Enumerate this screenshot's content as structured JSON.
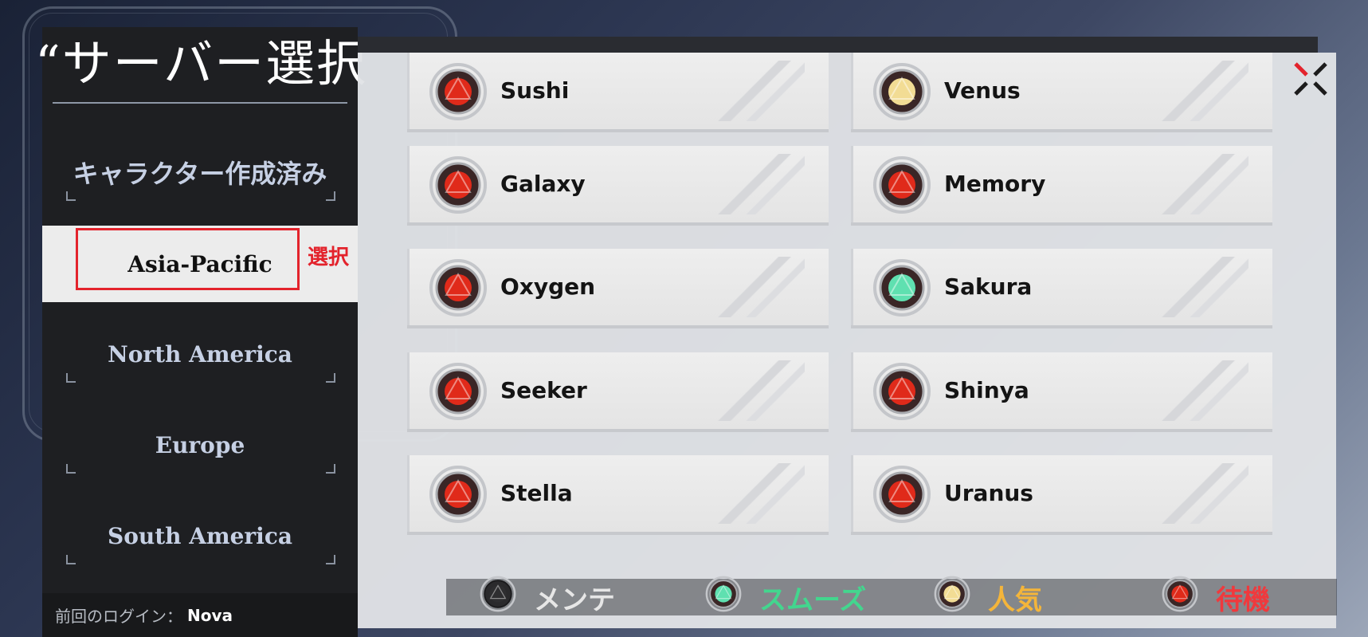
{
  "title": "“サーバー選択",
  "sidebar": {
    "created": "キャラクター作成済み",
    "regions": [
      "Asia-Pacific",
      "North America",
      "Europe",
      "South America"
    ],
    "selected_note": "選択",
    "last_login_label": "前回のログイン：",
    "last_login_value": "Nova"
  },
  "servers": [
    {
      "name": "Sushi",
      "status": "waiting"
    },
    {
      "name": "Venus",
      "status": "popular"
    },
    {
      "name": "Galaxy",
      "status": "waiting"
    },
    {
      "name": "Memory",
      "status": "waiting"
    },
    {
      "name": "Oxygen",
      "status": "waiting"
    },
    {
      "name": "Sakura",
      "status": "smooth"
    },
    {
      "name": "Seeker",
      "status": "waiting"
    },
    {
      "name": "Shinya",
      "status": "waiting"
    },
    {
      "name": "Stella",
      "status": "waiting"
    },
    {
      "name": "Uranus",
      "status": "waiting"
    }
  ],
  "legend": [
    {
      "label": "メンテ",
      "status": "maintenance"
    },
    {
      "label": "スムーズ",
      "status": "smooth"
    },
    {
      "label": "人気",
      "status": "popular"
    },
    {
      "label": "待機",
      "status": "waiting"
    }
  ],
  "colors": {
    "waiting": "#e02a1a",
    "popular": "#f2dc94",
    "smooth": "#5fe0b0",
    "maintenance": "#2e2e30",
    "legend_maintenance": "#e6e6e6",
    "legend_smooth": "#43d68e",
    "legend_popular": "#f4b53a",
    "legend_waiting": "#f0393d",
    "highlight": "#e3232c"
  }
}
